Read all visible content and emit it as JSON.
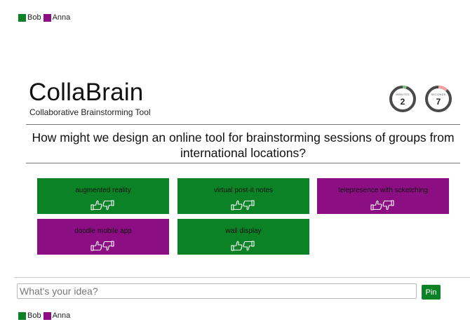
{
  "colors": {
    "green": "#0c8227",
    "purple": "#8b0e82",
    "text": "#111111"
  },
  "participants": [
    {
      "name": "Bob",
      "color": "#0c8227"
    },
    {
      "name": "Anna",
      "color": "#8b0e82"
    }
  ],
  "brand": {
    "title": "CollaBrain",
    "subtitle": "Collaborative Brainstorming Tool"
  },
  "timers": [
    {
      "label": "MINUTES",
      "value": "2",
      "elapsed_fraction": 0.05,
      "accent": "#7fbf7f"
    },
    {
      "label": "SECONDS",
      "value": "7",
      "elapsed_fraction": 0.12,
      "accent": "#f2a0a0"
    }
  ],
  "question": "How might we design an online tool for brainstorming sessions of groups from international locations?",
  "ideas": [
    {
      "text": "augmented reality",
      "author": "Bob",
      "color": "#0c8227",
      "icon": "thumbs-up-down-icon"
    },
    {
      "text": "virtual post-it notes",
      "author": "Bob",
      "color": "#0c8227",
      "icon": "thumbs-up-down-icon"
    },
    {
      "text": "telepresence with scketching",
      "author": "Anna",
      "color": "#8b0e82",
      "icon": "thumbs-up-down-icon"
    },
    {
      "text": "doodle mobile app",
      "author": "Anna",
      "color": "#8b0e82",
      "icon": "thumbs-up-down-icon"
    },
    {
      "text": "wall display",
      "author": "Bob",
      "color": "#0c8227",
      "icon": "thumbs-up-down-icon"
    }
  ],
  "composer": {
    "placeholder": "What's your idea?",
    "value": "",
    "button": "Pin"
  }
}
